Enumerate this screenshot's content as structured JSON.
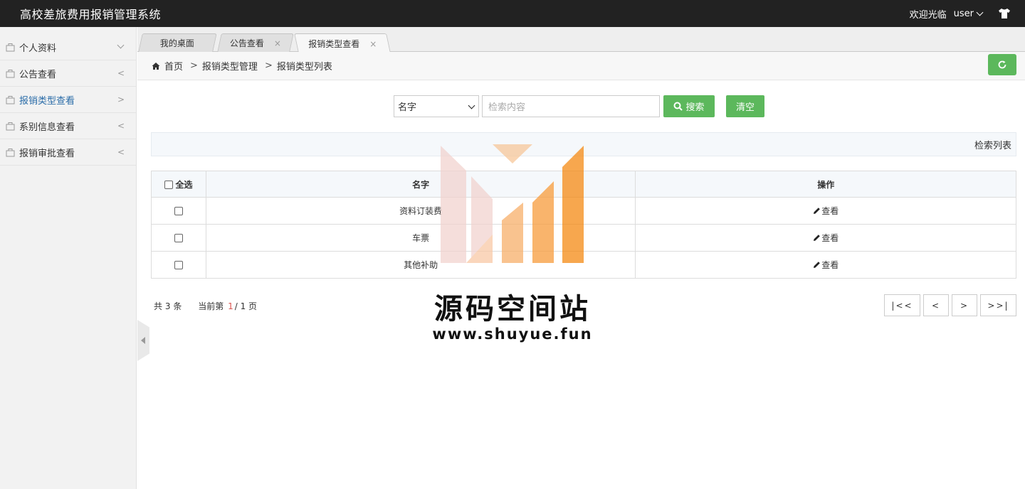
{
  "header": {
    "title": "高校差旅费用报销管理系统",
    "welcome": "欢迎光临",
    "username": "user",
    "icon": "shirt-icon"
  },
  "sidebar": {
    "items": [
      {
        "label": "个人资料",
        "arrow": "chevron-down",
        "active": false
      },
      {
        "label": "公告查看",
        "arrow": "<",
        "active": false
      },
      {
        "label": "报销类型查看",
        "arrow": ">",
        "active": true
      },
      {
        "label": "系别信息查看",
        "arrow": "<",
        "active": false
      },
      {
        "label": "报销审批查看",
        "arrow": "<",
        "active": false
      }
    ]
  },
  "tabs": [
    {
      "label": "我的桌面",
      "closable": false
    },
    {
      "label": "公告查看",
      "closable": true,
      "close": "×"
    },
    {
      "label": "报销类型查看",
      "closable": true,
      "close": "×",
      "active": true
    }
  ],
  "breadcrumb": {
    "home": "首页",
    "sep1": ">",
    "level1": "报销类型管理",
    "sep2": ">",
    "level2": "报销类型列表"
  },
  "search": {
    "field_selected": "名字",
    "placeholder": "检索内容",
    "search_label": "搜索",
    "clear_label": "清空"
  },
  "list_title": "检索列表",
  "table": {
    "headers": {
      "select_all": "全选",
      "name": "名字",
      "actions": "操作"
    },
    "rows": [
      {
        "name": "资料订装费",
        "action": "查看"
      },
      {
        "name": "车票",
        "action": "查看"
      },
      {
        "name": "其他补助",
        "action": "查看"
      }
    ]
  },
  "pager": {
    "total_prefix": "共",
    "total": "3",
    "total_suffix": "条",
    "current_prefix": "当前第",
    "current": "1",
    "slash": "/",
    "pages": "1",
    "pages_suffix": "页",
    "first": "|<<",
    "prev": "<",
    "next": ">",
    "last": ">>|"
  },
  "watermark": {
    "title": "源码空间站",
    "url": "www.shuyue.fun"
  },
  "colors": {
    "topbar": "#222222",
    "accent_green": "#5cb85c",
    "active_link": "#2a6ca8",
    "page_current": "#d9534f"
  }
}
